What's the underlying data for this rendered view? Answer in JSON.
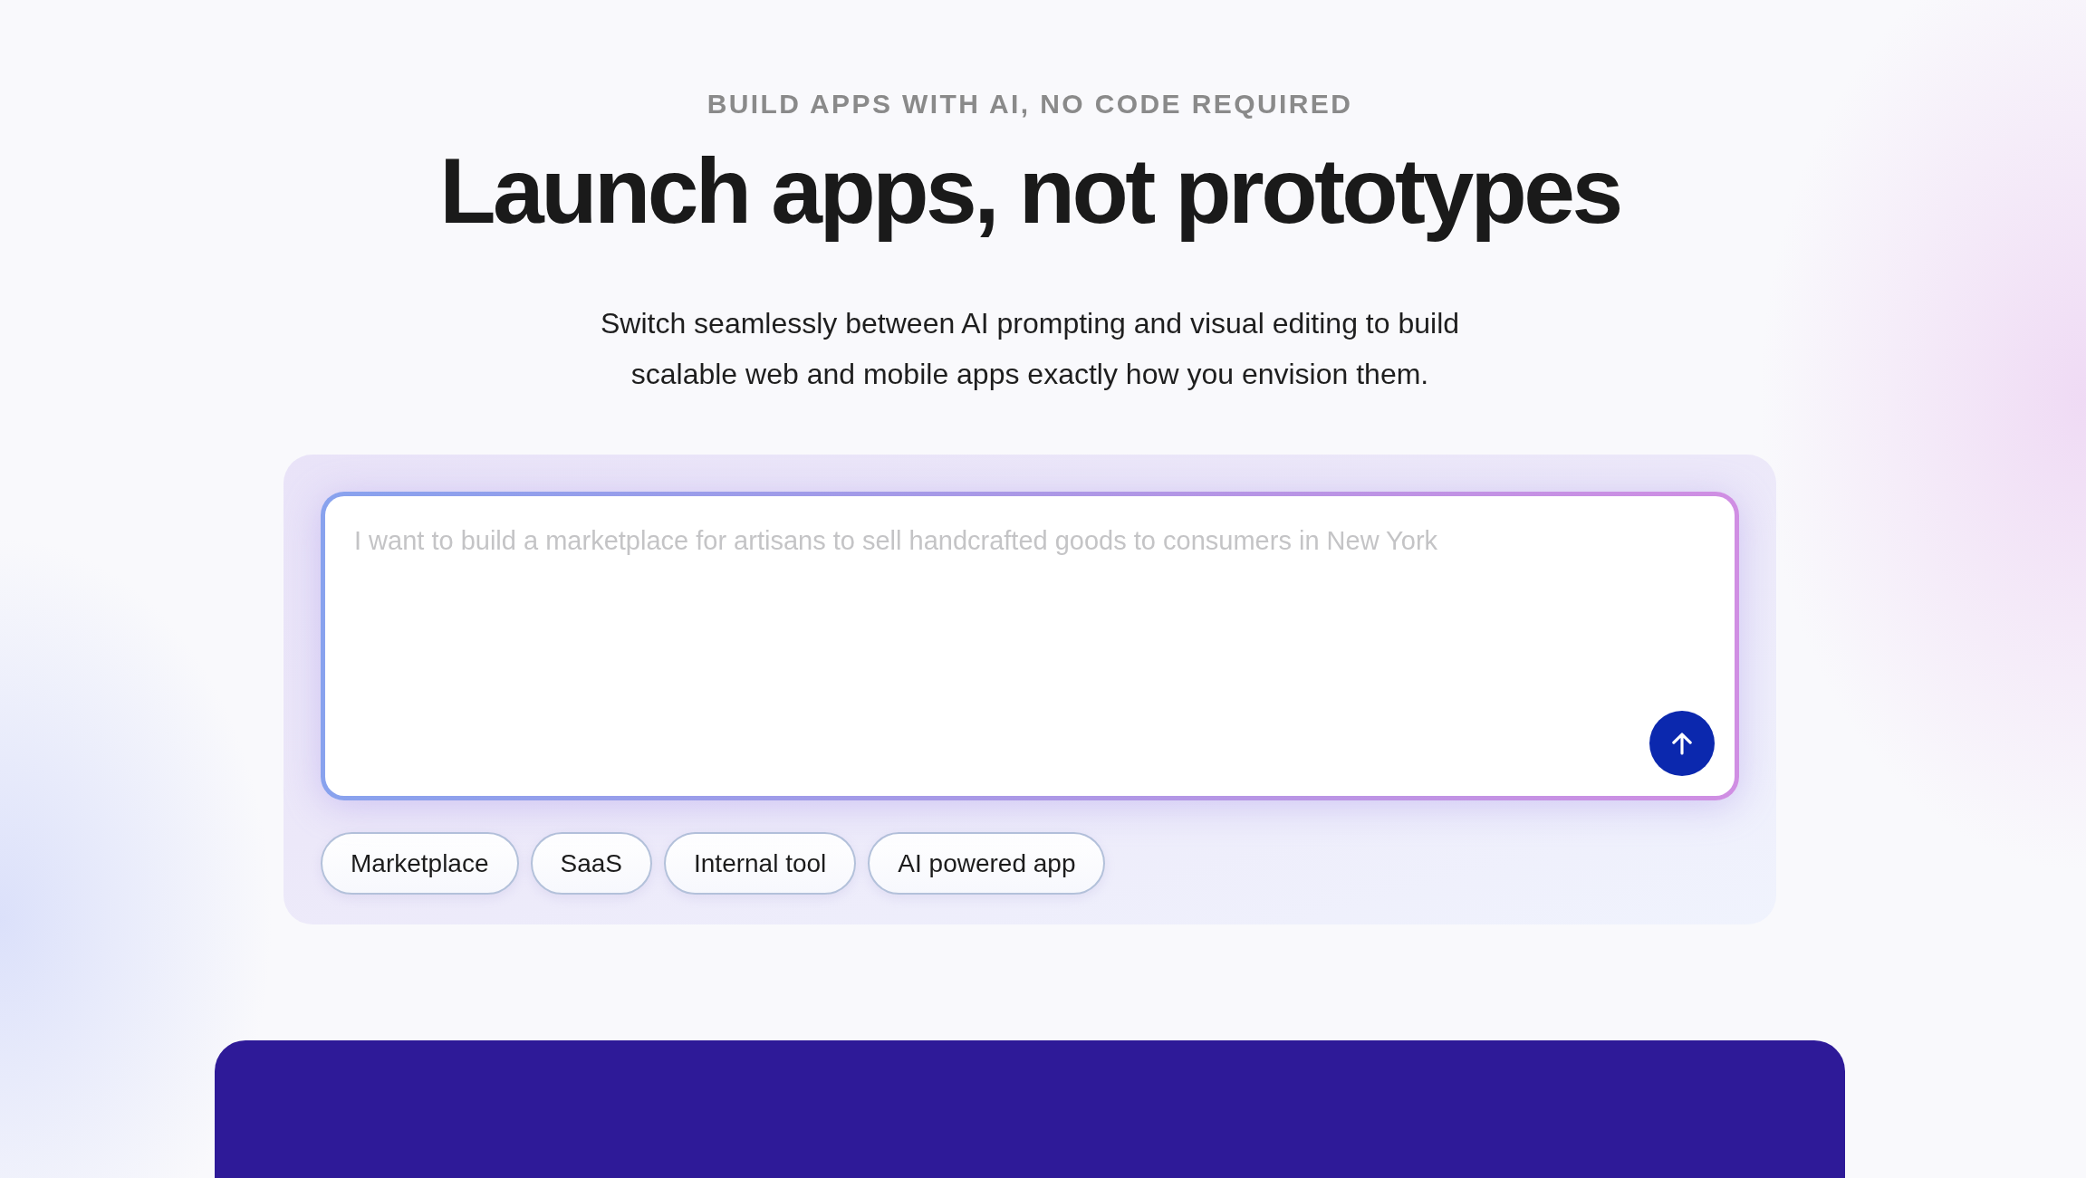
{
  "eyebrow": "BUILD APPS WITH AI, NO CODE REQUIRED",
  "title": "Launch apps, not prototypes",
  "subtitle_lines": [
    "Switch seamlessly between AI prompting and visual editing to build",
    "scalable web and mobile apps exactly how you envision them."
  ],
  "prompt": {
    "placeholder": "I want to build a marketplace for artisans to sell handcrafted goods to consumers in New York"
  },
  "suggestions": [
    "Marketplace",
    "SaaS",
    "Internal tool",
    "AI powered app"
  ]
}
